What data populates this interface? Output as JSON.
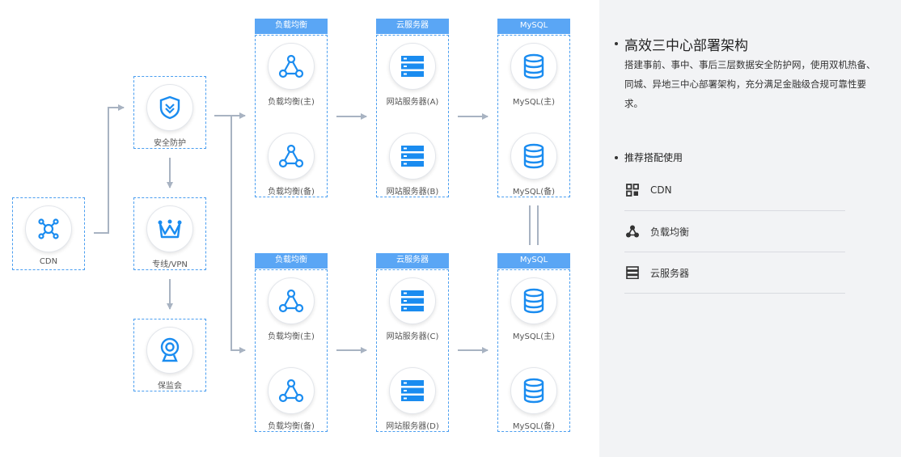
{
  "diagram": {
    "entry": {
      "cdn": {
        "label": "CDN",
        "icon": "network-hub-icon"
      }
    },
    "security": [
      {
        "label": "安全防护",
        "icon": "shield-check-icon"
      },
      {
        "label": "专线/VPN",
        "icon": "crown-icon"
      },
      {
        "label": "保监会",
        "icon": "webcam-icon"
      }
    ],
    "groups": {
      "lb_header": "负载均衡",
      "server_header": "云服务器",
      "db_header": "MySQL"
    },
    "upper": {
      "lb": [
        "负载均衡(主)",
        "负载均衡(备)"
      ],
      "servers": [
        "网站服务器(A)",
        "网站服务器(B)"
      ],
      "db": [
        "MySQL(主)",
        "MySQL(备)"
      ]
    },
    "lower": {
      "lb": [
        "负载均衡(主)",
        "负载均衡(备)"
      ],
      "servers": [
        "网站服务器(C)",
        "网站服务器(D)"
      ],
      "db": [
        "MySQL(主)",
        "MySQL(备)"
      ]
    },
    "colors": {
      "accent": "#1a8cf0",
      "header": "#5aa6f5",
      "arrow": "#a8b3c2"
    }
  },
  "panel": {
    "title": "高效三中心部署架构",
    "description": "搭建事前、事中、事后三层数据安全防护网，使用双机热备、同城、异地三中心部署架构，充分满足金融级合规可靠性要求。",
    "recommend_title": "推荐搭配使用",
    "items": [
      {
        "label": "CDN",
        "icon": "grid-icon"
      },
      {
        "label": "负载均衡",
        "icon": "load-balance-icon"
      },
      {
        "label": "云服务器",
        "icon": "server-icon"
      }
    ]
  }
}
